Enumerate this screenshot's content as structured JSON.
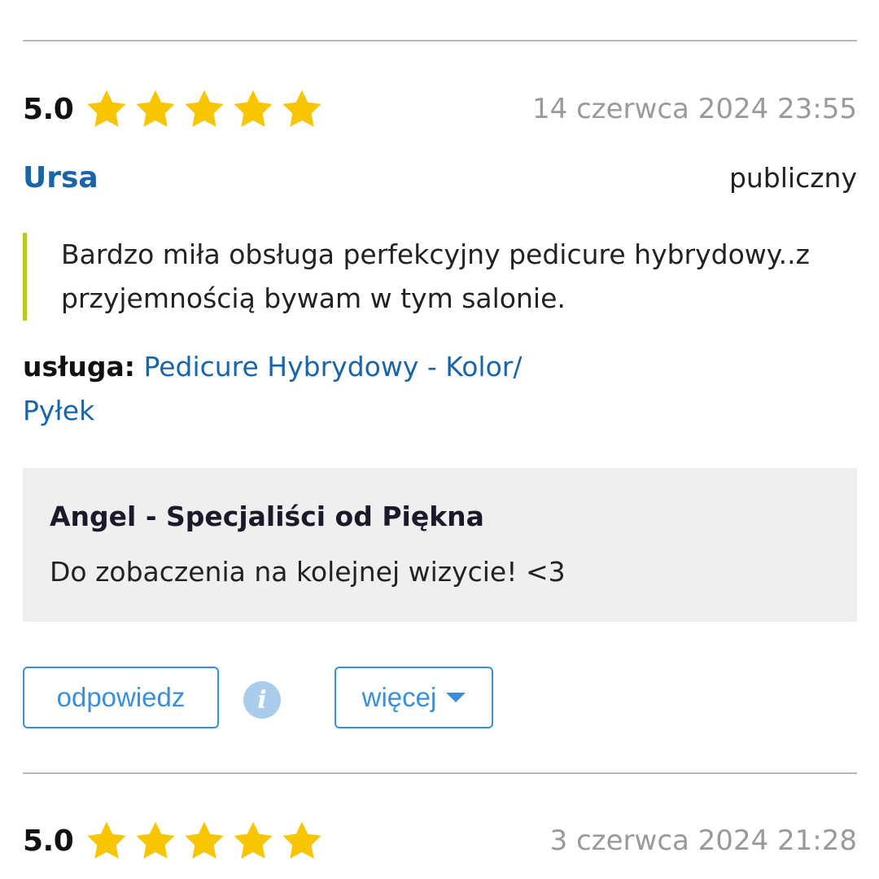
{
  "reviews": [
    {
      "score": "5.0",
      "stars": 5,
      "date": "14 czerwca 2024 23:55",
      "author": "Ursa",
      "visibility": "publiczny",
      "text": "Bardzo miła obsługa perfekcyjny pedicure hybrydowy..z przyjemnością bywam w tym salonie.",
      "service_label": "usługa:",
      "service_name": "Pedicure Hybrydowy - Kolor/ Pyłek",
      "reply": {
        "author": "Angel - Specjaliści od Piękna",
        "text": "Do zobaczenia na kolejnej wizycie! <3"
      },
      "actions": {
        "reply_label": "odpowiedz",
        "more_label": "więcej",
        "info_icon": "i"
      }
    },
    {
      "score": "5.0",
      "stars": 5,
      "date": "3 czerwca 2024 21:28"
    }
  ],
  "colors": {
    "star": "#f7c600",
    "link": "#1a64a8",
    "accent_border": "#b5c92b",
    "button": "#3a8fd9"
  }
}
